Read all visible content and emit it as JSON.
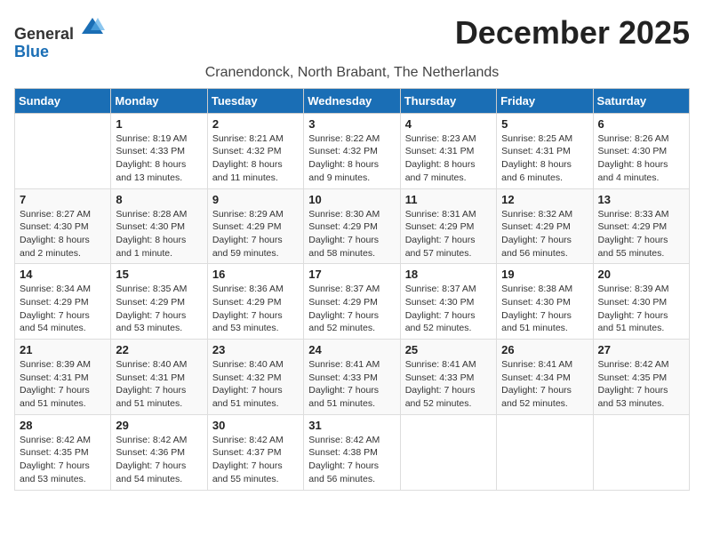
{
  "logo": {
    "general": "General",
    "blue": "Blue"
  },
  "title": "December 2025",
  "location": "Cranendonck, North Brabant, The Netherlands",
  "days_header": [
    "Sunday",
    "Monday",
    "Tuesday",
    "Wednesday",
    "Thursday",
    "Friday",
    "Saturday"
  ],
  "weeks": [
    [
      {
        "day": "",
        "info": ""
      },
      {
        "day": "1",
        "info": "Sunrise: 8:19 AM\nSunset: 4:33 PM\nDaylight: 8 hours\nand 13 minutes."
      },
      {
        "day": "2",
        "info": "Sunrise: 8:21 AM\nSunset: 4:32 PM\nDaylight: 8 hours\nand 11 minutes."
      },
      {
        "day": "3",
        "info": "Sunrise: 8:22 AM\nSunset: 4:32 PM\nDaylight: 8 hours\nand 9 minutes."
      },
      {
        "day": "4",
        "info": "Sunrise: 8:23 AM\nSunset: 4:31 PM\nDaylight: 8 hours\nand 7 minutes."
      },
      {
        "day": "5",
        "info": "Sunrise: 8:25 AM\nSunset: 4:31 PM\nDaylight: 8 hours\nand 6 minutes."
      },
      {
        "day": "6",
        "info": "Sunrise: 8:26 AM\nSunset: 4:30 PM\nDaylight: 8 hours\nand 4 minutes."
      }
    ],
    [
      {
        "day": "7",
        "info": "Sunrise: 8:27 AM\nSunset: 4:30 PM\nDaylight: 8 hours\nand 2 minutes."
      },
      {
        "day": "8",
        "info": "Sunrise: 8:28 AM\nSunset: 4:30 PM\nDaylight: 8 hours\nand 1 minute."
      },
      {
        "day": "9",
        "info": "Sunrise: 8:29 AM\nSunset: 4:29 PM\nDaylight: 7 hours\nand 59 minutes."
      },
      {
        "day": "10",
        "info": "Sunrise: 8:30 AM\nSunset: 4:29 PM\nDaylight: 7 hours\nand 58 minutes."
      },
      {
        "day": "11",
        "info": "Sunrise: 8:31 AM\nSunset: 4:29 PM\nDaylight: 7 hours\nand 57 minutes."
      },
      {
        "day": "12",
        "info": "Sunrise: 8:32 AM\nSunset: 4:29 PM\nDaylight: 7 hours\nand 56 minutes."
      },
      {
        "day": "13",
        "info": "Sunrise: 8:33 AM\nSunset: 4:29 PM\nDaylight: 7 hours\nand 55 minutes."
      }
    ],
    [
      {
        "day": "14",
        "info": "Sunrise: 8:34 AM\nSunset: 4:29 PM\nDaylight: 7 hours\nand 54 minutes."
      },
      {
        "day": "15",
        "info": "Sunrise: 8:35 AM\nSunset: 4:29 PM\nDaylight: 7 hours\nand 53 minutes."
      },
      {
        "day": "16",
        "info": "Sunrise: 8:36 AM\nSunset: 4:29 PM\nDaylight: 7 hours\nand 53 minutes."
      },
      {
        "day": "17",
        "info": "Sunrise: 8:37 AM\nSunset: 4:29 PM\nDaylight: 7 hours\nand 52 minutes."
      },
      {
        "day": "18",
        "info": "Sunrise: 8:37 AM\nSunset: 4:30 PM\nDaylight: 7 hours\nand 52 minutes."
      },
      {
        "day": "19",
        "info": "Sunrise: 8:38 AM\nSunset: 4:30 PM\nDaylight: 7 hours\nand 51 minutes."
      },
      {
        "day": "20",
        "info": "Sunrise: 8:39 AM\nSunset: 4:30 PM\nDaylight: 7 hours\nand 51 minutes."
      }
    ],
    [
      {
        "day": "21",
        "info": "Sunrise: 8:39 AM\nSunset: 4:31 PM\nDaylight: 7 hours\nand 51 minutes."
      },
      {
        "day": "22",
        "info": "Sunrise: 8:40 AM\nSunset: 4:31 PM\nDaylight: 7 hours\nand 51 minutes."
      },
      {
        "day": "23",
        "info": "Sunrise: 8:40 AM\nSunset: 4:32 PM\nDaylight: 7 hours\nand 51 minutes."
      },
      {
        "day": "24",
        "info": "Sunrise: 8:41 AM\nSunset: 4:33 PM\nDaylight: 7 hours\nand 51 minutes."
      },
      {
        "day": "25",
        "info": "Sunrise: 8:41 AM\nSunset: 4:33 PM\nDaylight: 7 hours\nand 52 minutes."
      },
      {
        "day": "26",
        "info": "Sunrise: 8:41 AM\nSunset: 4:34 PM\nDaylight: 7 hours\nand 52 minutes."
      },
      {
        "day": "27",
        "info": "Sunrise: 8:42 AM\nSunset: 4:35 PM\nDaylight: 7 hours\nand 53 minutes."
      }
    ],
    [
      {
        "day": "28",
        "info": "Sunrise: 8:42 AM\nSunset: 4:35 PM\nDaylight: 7 hours\nand 53 minutes."
      },
      {
        "day": "29",
        "info": "Sunrise: 8:42 AM\nSunset: 4:36 PM\nDaylight: 7 hours\nand 54 minutes."
      },
      {
        "day": "30",
        "info": "Sunrise: 8:42 AM\nSunset: 4:37 PM\nDaylight: 7 hours\nand 55 minutes."
      },
      {
        "day": "31",
        "info": "Sunrise: 8:42 AM\nSunset: 4:38 PM\nDaylight: 7 hours\nand 56 minutes."
      },
      {
        "day": "",
        "info": ""
      },
      {
        "day": "",
        "info": ""
      },
      {
        "day": "",
        "info": ""
      }
    ]
  ]
}
